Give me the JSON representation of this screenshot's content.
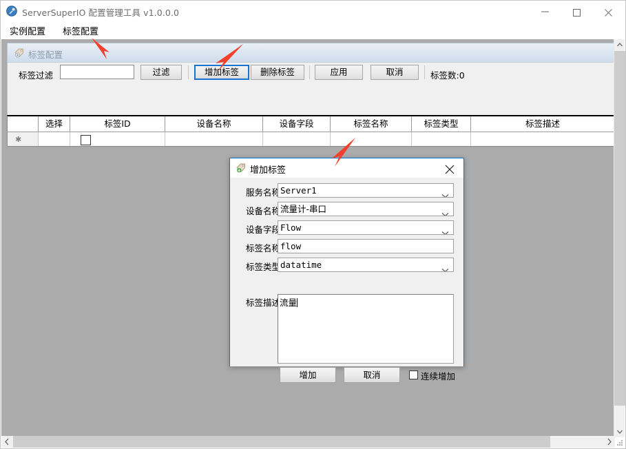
{
  "window": {
    "title": "ServerSuperIO 配置管理工具 v1.0.0.0",
    "icon": "app-icon",
    "minimize_label": "—",
    "maximize_label": "□",
    "close_label": "✕"
  },
  "menubar": {
    "items": [
      {
        "label": "实例配置"
      },
      {
        "label": "标签配置"
      }
    ]
  },
  "panel": {
    "title": "标签配置",
    "icon": "tag-gear-icon"
  },
  "toolbar": {
    "filter_label": "标签过滤",
    "filter_value": "",
    "filter_placeholder": "",
    "filter_button": "过滤",
    "add_tag_button": "增加标签",
    "delete_tag_button": "删除标签",
    "apply_button": "应用",
    "cancel_button": "取消",
    "tag_count_text": "标签数:0",
    "focused_button": "增加标签",
    "focus_color": "#1673d1"
  },
  "grid": {
    "columns": [
      {
        "label": "",
        "key": "marker"
      },
      {
        "label": "选择",
        "key": "select"
      },
      {
        "label": "标签ID",
        "key": "tag_id"
      },
      {
        "label": "设备名称",
        "key": "device_name"
      },
      {
        "label": "设备字段",
        "key": "device_field"
      },
      {
        "label": "标签名称",
        "key": "tag_name"
      },
      {
        "label": "标签类型",
        "key": "tag_type"
      },
      {
        "label": "标签描述",
        "key": "tag_desc"
      }
    ],
    "rows": [
      {
        "marker": "✱",
        "select": "",
        "tag_id": "",
        "device_name": "",
        "device_field": "",
        "tag_name": "",
        "tag_type": "",
        "tag_desc": ""
      }
    ]
  },
  "dialog": {
    "title": "增加标签",
    "icon": "tag-add-icon",
    "close_label": "✕",
    "fields": [
      {
        "label": "服务名称",
        "value": "Server1",
        "type": "combobox"
      },
      {
        "label": "设备名称",
        "value": "流量计-串口",
        "type": "combobox"
      },
      {
        "label": "设备字段",
        "value": "Flow",
        "type": "combobox"
      },
      {
        "label": "标签名称",
        "value": "flow",
        "type": "textbox"
      },
      {
        "label": "标签类型",
        "value": "datatime",
        "type": "combobox"
      }
    ],
    "description_label": "标签描述",
    "description_value": "流量",
    "ok_button": "增加",
    "cancel_button": "取消",
    "continuous_checkbox_label": "连续增加",
    "continuous_checked": false
  },
  "annotations": {
    "arrows": [
      {
        "name": "arrow-to-tag-config-menu",
        "color": "#f4402e"
      },
      {
        "name": "arrow-to-add-tag-button",
        "color": "#f4402e"
      },
      {
        "name": "arrow-to-dialog",
        "color": "#f4402e"
      }
    ]
  },
  "colors": {
    "client_background": "#ababab",
    "panel_background": "#f0f0f0",
    "accent": "#0078d7",
    "annotation_red": "#f4402e"
  }
}
